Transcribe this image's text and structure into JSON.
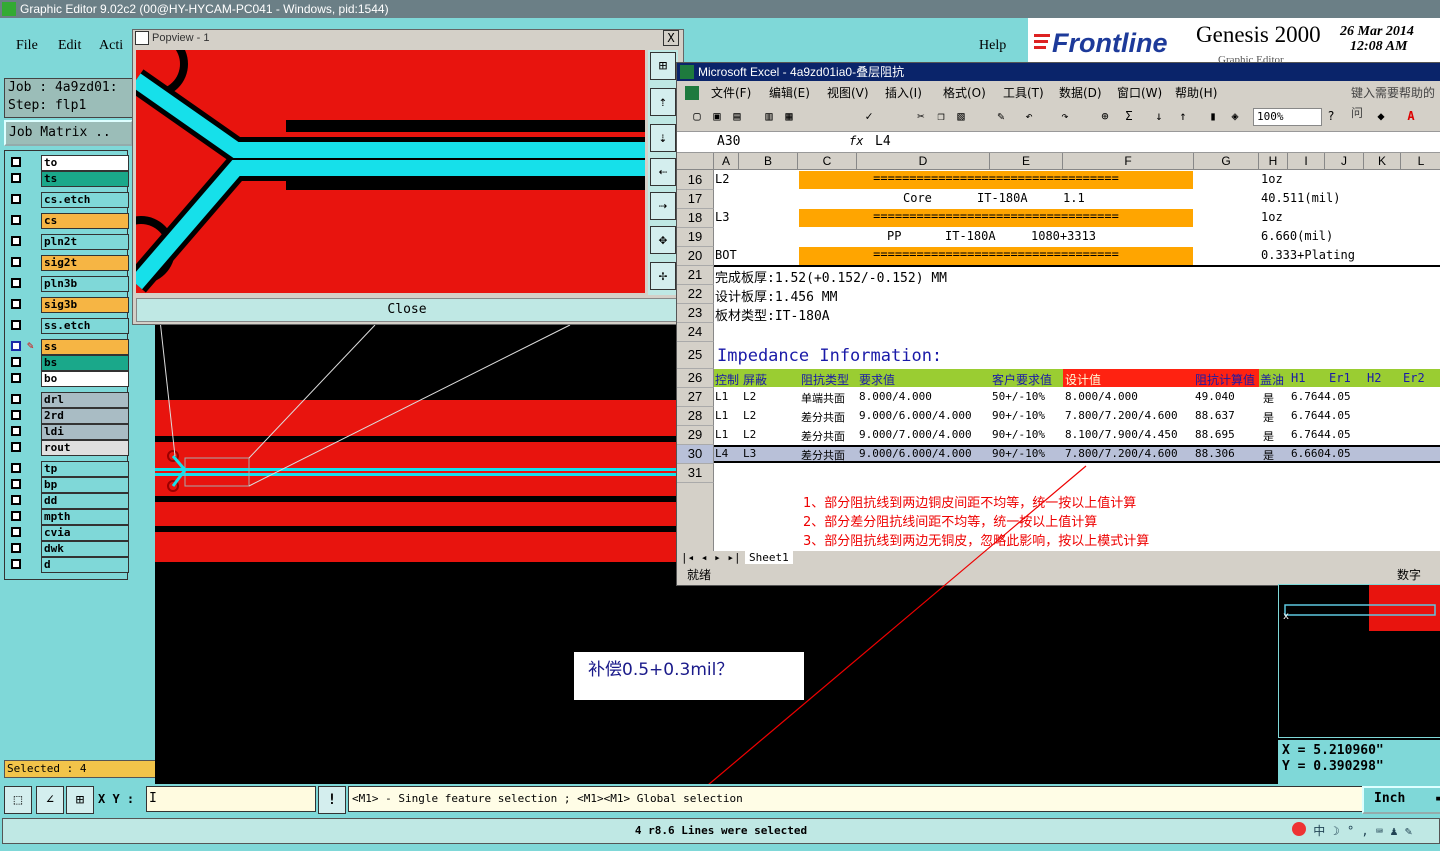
{
  "window_title": "Graphic Editor 9.02c2 (00@HY-HYCAM-PC041 - Windows, pid:1544)",
  "menu": {
    "file": "File",
    "edit": "Edit",
    "action": "Acti",
    "help": "Help"
  },
  "logo": {
    "brand": "Frontline",
    "product": "Genesis 2000",
    "subtitle": "Graphic Editor",
    "date": "26 Mar 2014",
    "time": "12:08 AM"
  },
  "job": {
    "job_label": "Job : 4a9zd01:",
    "step_label": "Step: flp1",
    "matrix_button": "Job Matrix .."
  },
  "layers": [
    {
      "name": "to",
      "color": "#ffffff"
    },
    {
      "name": "ts",
      "color": "#1aa88a"
    },
    {
      "name": "cs.etch",
      "color": "#7fd8d8"
    },
    {
      "name": "cs",
      "color": "#f6b544"
    },
    {
      "name": "pln2t",
      "color": "#7fd8d8"
    },
    {
      "name": "sig2t",
      "color": "#f6b544"
    },
    {
      "name": "pln3b",
      "color": "#7fd8d8"
    },
    {
      "name": "sig3b",
      "color": "#f6b544"
    },
    {
      "name": "ss.etch",
      "color": "#7fd8d8"
    },
    {
      "name": "ss",
      "color": "#f6b544"
    },
    {
      "name": "bs",
      "color": "#1aa88a"
    },
    {
      "name": "bo",
      "color": "#ffffff"
    },
    {
      "name": "drl",
      "color": "#a9bcc4"
    },
    {
      "name": "2rd",
      "color": "#a9bcc4"
    },
    {
      "name": "ldi",
      "color": "#a9bcc4"
    },
    {
      "name": "rout",
      "color": "#e0e0e0"
    },
    {
      "name": "tp",
      "color": "#7fd8d8"
    },
    {
      "name": "bp",
      "color": "#7fd8d8"
    },
    {
      "name": "dd",
      "color": "#7fd8d8"
    },
    {
      "name": "mpth",
      "color": "#7fd8d8"
    },
    {
      "name": "cvia",
      "color": "#7fd8d8"
    },
    {
      "name": "dwk",
      "color": "#7fd8d8"
    },
    {
      "name": "d",
      "color": "#7fd8d8"
    }
  ],
  "selected_count": "Selected : 4",
  "popview": {
    "title": "Popview - 1",
    "close_x": "X",
    "close_button": "Close"
  },
  "excel": {
    "title": "Microsoft Excel - 4a9zd01ia0-叠层阻抗",
    "menu": [
      "文件(F)",
      "编辑(E)",
      "视图(V)",
      "插入(I)",
      "格式(O)",
      "工具(T)",
      "数据(D)",
      "窗口(W)",
      "帮助(H)"
    ],
    "help_prompt": "键入需要帮助的问",
    "zoom": "100%",
    "name_box": "A30",
    "fx": "fx",
    "formula": "L4",
    "columns": [
      "A",
      "B",
      "C",
      "D",
      "E",
      "F",
      "G",
      "H",
      "I",
      "J",
      "K",
      "L"
    ],
    "rows": [
      "16",
      "17",
      "18",
      "19",
      "20",
      "21",
      "22",
      "23",
      "24",
      "25",
      "26",
      "27",
      "28",
      "29",
      "30",
      "31"
    ],
    "r16": {
      "a": "L2",
      "bar": "==================================",
      "h": "1oz"
    },
    "r17": {
      "core": "Core",
      "material": "IT-180A",
      "value": "1.1",
      "h": "40.511(mil)"
    },
    "r18": {
      "a": "L3",
      "bar": "==================================",
      "h": "1oz"
    },
    "r19": {
      "pp": "PP",
      "material": "IT-180A",
      "value": "1080+3313",
      "h": "6.660(mil)"
    },
    "r20": {
      "a": "BOT",
      "bar": "==================================",
      "h": "0.333+Plating"
    },
    "r21": "完成板厚:1.52(+0.152/-0.152) MM",
    "r22": "设计板厚:1.456 MM",
    "r23": "板材类型:IT-180A",
    "r25": "Impedance Information:",
    "r26": {
      "ctrl": "控制",
      "shield": "屏蔽",
      "type": "阻抗类型",
      "req": "要求值",
      "cust": "客户要求值",
      "design": "设计值",
      "calc": "阻抗计算值",
      "ink": "盖油",
      "h1": "H1",
      "er1": "Er1",
      "h2": "H2",
      "er2": "Er2"
    },
    "imp_rows": [
      {
        "ctrl": "L1",
        "shield": "L2",
        "type": "单端共面",
        "req": "8.000/4.000",
        "cust": "50+/-10%",
        "design": "8.000/4.000",
        "calc": "49.040",
        "ink": "是",
        "h1er1": "6.7644.05"
      },
      {
        "ctrl": "L1",
        "shield": "L2",
        "type": "差分共面",
        "req": "9.000/6.000/4.000",
        "cust": "90+/-10%",
        "design": "7.800/7.200/4.600",
        "calc": "88.637",
        "ink": "是",
        "h1er1": "6.7644.05"
      },
      {
        "ctrl": "L1",
        "shield": "L2",
        "type": "差分共面",
        "req": "9.000/7.000/4.000",
        "cust": "90+/-10%",
        "design": "8.100/7.900/4.450",
        "calc": "88.695",
        "ink": "是",
        "h1er1": "6.7644.05"
      },
      {
        "ctrl": "L4",
        "shield": "L3",
        "type": "差分共面",
        "req": "9.000/6.000/4.000",
        "cust": "90+/-10%",
        "design": "7.800/7.200/4.600",
        "calc": "88.306",
        "ink": "是",
        "h1er1": "6.6604.05"
      }
    ],
    "notes": [
      "1、部分阻抗线到两边铜皮间距不均等，统一按以上值计算",
      "2、部分差分阻抗线间距不均等，统一按以上值计算",
      "3、部分阻抗线到两边无铜皮，忽略此影响，按以上模式计算"
    ],
    "sheet_tab": "Sheet1",
    "status_ready": "就绪",
    "status_num": "数字"
  },
  "annotation": "补偿0.5+0.3mil？",
  "coords": {
    "x": "X = 5.210960\"",
    "y": "Y = 0.390298\""
  },
  "bottom": {
    "xy_label": "X Y :",
    "xy_value": "I",
    "bang": "!",
    "message": "<M1> - Single feature selection ; <M1><M1> Global selection",
    "unit": "Inch",
    "status": "4 r8.6 Lines were selected"
  }
}
